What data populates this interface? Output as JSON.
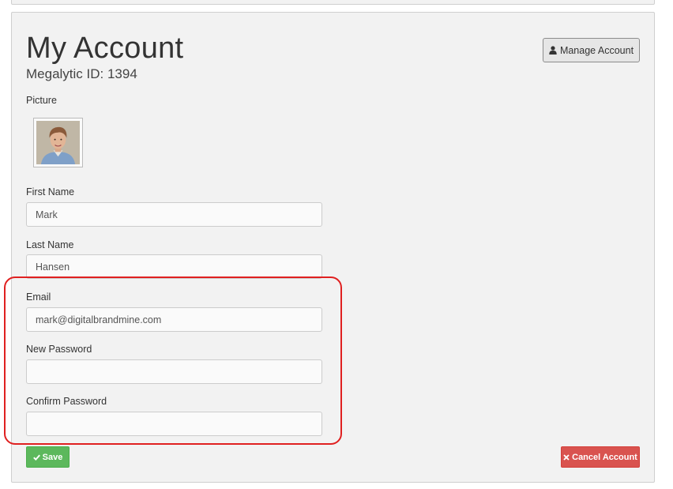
{
  "header": {
    "title": "My Account",
    "subtitle": "Megalytic ID: 1394",
    "manage_button": {
      "label": "Manage Account",
      "icon": "user-icon"
    }
  },
  "picture": {
    "label": "Picture"
  },
  "form": {
    "first_name": {
      "label": "First Name",
      "value": "Mark"
    },
    "last_name": {
      "label": "Last Name",
      "value": "Hansen"
    },
    "email": {
      "label": "Email",
      "value": "mark@digitalbrandmine.com"
    },
    "new_password": {
      "label": "New Password",
      "value": ""
    },
    "confirm_password": {
      "label": "Confirm Password",
      "value": ""
    }
  },
  "actions": {
    "save": {
      "label": "Save",
      "icon": "check-icon",
      "color": "#5cb85c"
    },
    "cancel_account": {
      "label": "Cancel Account",
      "icon": "x-icon",
      "color": "#d9534f"
    }
  },
  "annotation": {
    "highlight_color": "#e02020"
  }
}
